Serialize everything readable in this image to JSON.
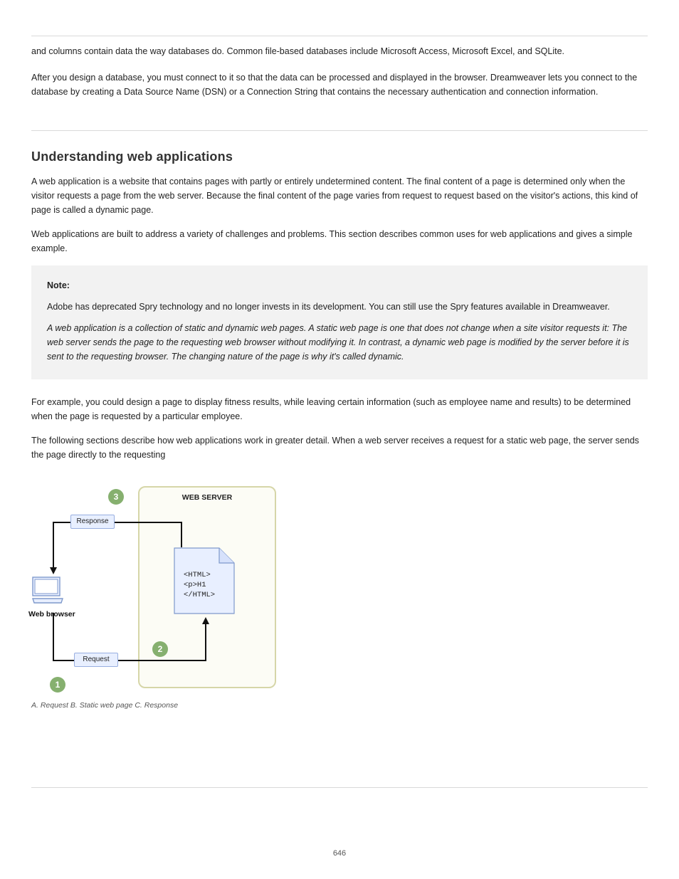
{
  "top": {
    "lead": "and columns contain data the way databases do. Common file-based databases include Microsoft Access, Microsoft Excel, and SQLite.",
    "para": "After you design a database, you must connect to it so that the data can be processed and displayed in the browser. Dreamweaver lets you connect to the database by creating a Data Source Name (DSN) or a Connection String that contains the necessary authentication and connection information."
  },
  "section_title": "Understanding web applications",
  "p1": "A web application is a website that contains pages with partly or entirely undetermined content. The final content of a page is determined only when the visitor requests a page from the web server. Because the final content of the page varies from request to request based on the visitor's actions, this kind of page is called a dynamic page.",
  "p2": "Web applications are built to address a variety of challenges and problems. This section describes common uses for web applications and gives a simple example.",
  "note": {
    "head": "Note:",
    "p1": "Adobe has deprecated Spry technology and no longer invests in its development. You can still use the Spry features available in Dreamweaver.",
    "p2": "A web application is a collection of static and dynamic web pages. A static web page is one that does not change when a site visitor requests it: The web server sends the page to the requesting web browser without modifying it. In contrast, a dynamic web page is modified by the server before it is sent to the requesting browser. The changing nature of the page is why it's called dynamic."
  },
  "p3": "For example, you could design a page to display fitness results, while leaving certain information (such as employee name and results) to be determined when the page is requested by a particular employee.",
  "p4": "The following sections describe how web applications work in greater detail. When a web server receives a request for a static web page, the server sends the page directly to the requesting",
  "diagram": {
    "server_title": "WEB SERVER",
    "file_line1": "<HTML>",
    "file_line2": "<p>H1",
    "file_line3": "</HTML>",
    "browser_label": "Web browser",
    "response_label": "Response",
    "request_label": "Request",
    "badge1": "1",
    "badge2": "2",
    "badge3": "3"
  },
  "caption": "A. Request B. Static web page C. Response",
  "page_number": "646"
}
